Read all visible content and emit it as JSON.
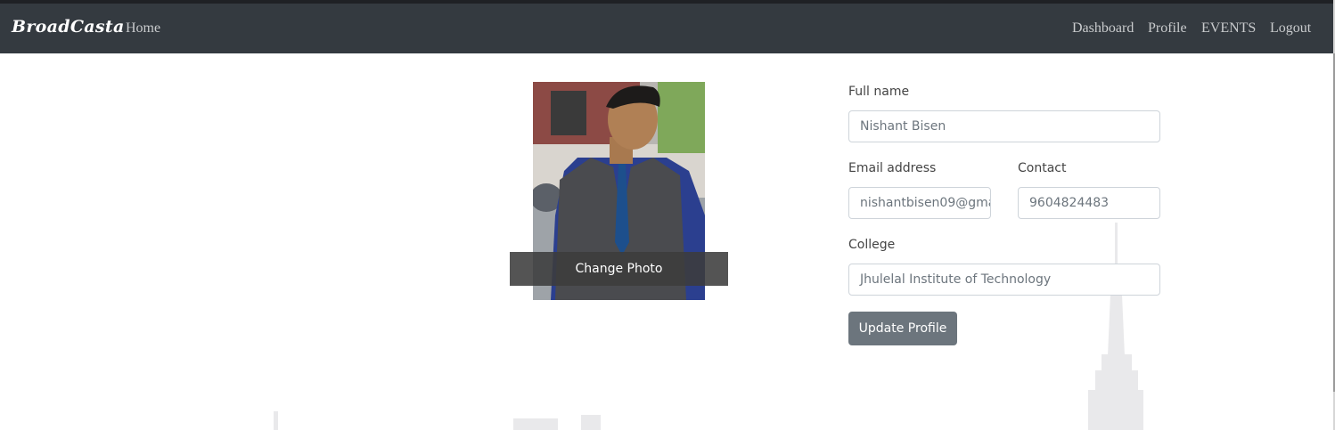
{
  "navbar": {
    "brand": "BroadCasta",
    "home": "Home",
    "right_links": [
      "Dashboard",
      "Profile",
      "EVENTS",
      "Logout"
    ]
  },
  "photo": {
    "change_label": "Change Photo"
  },
  "form": {
    "full_name_label": "Full name",
    "full_name_value": "Nishant Bisen",
    "email_label": "Email address",
    "email_value": "nishantbisen09@gma",
    "contact_label": "Contact",
    "contact_value": "9604824483",
    "college_label": "College",
    "college_value": "Jhulelal Institute of Technology",
    "update_button": "Update Profile"
  },
  "colors": {
    "navbar_bg": "#343a40",
    "button_bg": "#6c757d"
  }
}
